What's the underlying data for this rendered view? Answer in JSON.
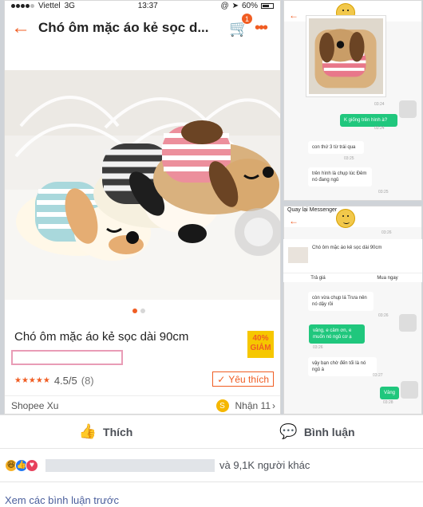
{
  "left_phone": {
    "status": {
      "carrier": "Viettel",
      "network": "3G",
      "time": "13:37",
      "battery": "60%"
    },
    "header": {
      "title": "Chó ôm mặc áo kẻ sọc d...",
      "cart_count": "1",
      "more": "•••"
    },
    "product": {
      "name": "Chó ôm mặc áo kẻ sọc dài 90cm",
      "discount_line1": "40%",
      "discount_line2": "GIẢM",
      "rating": "4.5/5",
      "rating_count": "(8)",
      "like_label": "Yêu thích"
    },
    "shop": {
      "name": "Shopee Xu",
      "receive": "Nhận 11"
    }
  },
  "chat_top": {
    "messages": [
      {
        "text": "K giống trên hình à?"
      },
      {
        "text": "con thứ 3 từ trái qua"
      },
      {
        "text": "trên hình là chụp lúc Đêm nó đang ngủ"
      }
    ],
    "times": [
      "03:24",
      "03:24",
      "03:25",
      "03:25"
    ]
  },
  "chat_bottom": {
    "status": "Quay lại Messenger",
    "card": {
      "title": "Chó ôm mặc áo kẻ sọc dài 90cm",
      "action_left": "Trả giá",
      "action_right": "Mua ngay"
    },
    "messages": [
      {
        "text": "còn vừa chụp lá Trưa nên nó dậy rồi"
      },
      {
        "text": "vâng, e cảm ơn, e muốn nó ngủ cơ ạ"
      },
      {
        "text": "vậy bạn chờ đến tối là nó ngủ à"
      },
      {
        "text": "Vâng"
      }
    ],
    "times": [
      "03:26",
      "03:26",
      "03:26",
      "03:27",
      "03:28"
    ]
  },
  "post": {
    "like_label": "Thích",
    "comment_label": "Bình luận",
    "reaction_count": "và 9,1K người khác",
    "previous_comments": "Xem các bình luận trước"
  }
}
